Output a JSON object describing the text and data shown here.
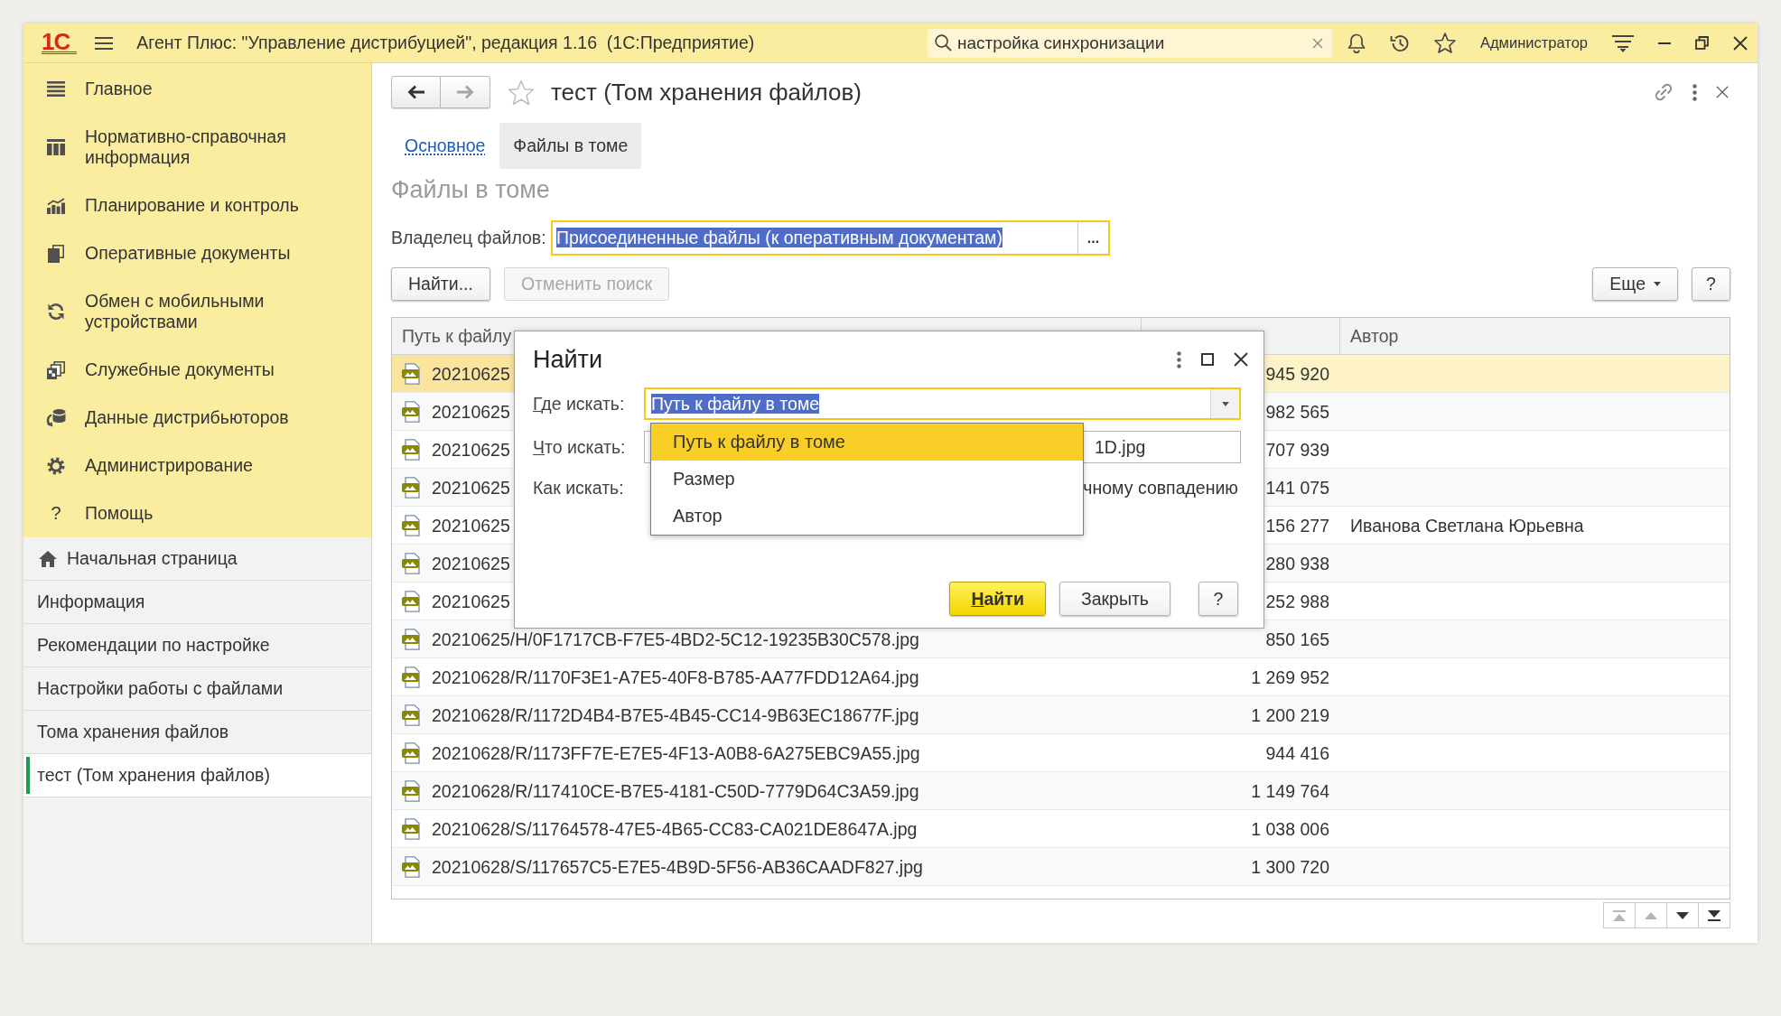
{
  "app_bar": {
    "logo": "1С",
    "title": "Агент Плюс: \"Управление дистрибуцией\", редакция 1.16  (1С:Предприятие)",
    "search": {
      "value": "настройка синхронизации"
    },
    "user": "Администратор"
  },
  "sidebar": {
    "sections": [
      {
        "label": "Главное"
      },
      {
        "label": "Нормативно-справочная информация"
      },
      {
        "label": "Планирование и контроль"
      },
      {
        "label": "Оперативные документы"
      },
      {
        "label": "Обмен с мобильными устройствами"
      },
      {
        "label": "Служебные документы"
      },
      {
        "label": "Данные дистрибьюторов"
      },
      {
        "label": "Администрирование"
      },
      {
        "label": "Помощь",
        "glyph": "?"
      }
    ],
    "open_pages": [
      {
        "kind": "home",
        "label": "Начальная страница",
        "selected": false
      },
      {
        "kind": "page",
        "label": "Информация",
        "selected": false
      },
      {
        "kind": "page",
        "label": "Рекомендации по настройке",
        "selected": false
      },
      {
        "kind": "page",
        "label": "Настройки работы с файлами",
        "selected": false
      },
      {
        "kind": "page",
        "label": "Тома хранения файлов",
        "selected": false
      },
      {
        "kind": "page",
        "label": "тест (Том хранения файлов)",
        "selected": true
      }
    ]
  },
  "page": {
    "nav": {
      "back_disabled": false,
      "forward_disabled": true
    },
    "favorite": false,
    "title": "тест (Том хранения файлов)",
    "tabs": [
      {
        "label": "Основное",
        "selected": false
      },
      {
        "label": "Файлы в томе",
        "selected": true
      }
    ],
    "section_title": "Файлы в томе",
    "owner_field": {
      "label": "Владелец файлов:",
      "value": "Присоединенные файлы (к оперативным документам)",
      "choice_button": "...",
      "focused": true
    },
    "toolbar_left": [
      {
        "kind": "button",
        "label": "Найти...",
        "disabled": false
      },
      {
        "kind": "button",
        "label": "Отменить поиск",
        "disabled": true
      }
    ],
    "toolbar_right": [
      {
        "kind": "menu",
        "label": "Еще",
        "disabled": false
      },
      {
        "kind": "help",
        "label": "?",
        "disabled": false
      }
    ],
    "table": {
      "columns": [
        {
          "kind": "path",
          "label": "Путь к файлу"
        },
        {
          "kind": "size"
        },
        {
          "kind": "author",
          "label": "Автор"
        }
      ],
      "rows": [
        {
          "path": "20210625",
          "size": "945 920",
          "selected": true
        },
        {
          "path": "20210625",
          "size": "982 565",
          "selected": false
        },
        {
          "path": "20210625",
          "size": "707 939",
          "selected": false
        },
        {
          "path": "20210625",
          "size": "141 075",
          "selected": false
        },
        {
          "path": "20210625",
          "size": "156 277",
          "author": "Иванова Светлана Юрьевна",
          "selected": false
        },
        {
          "path": "20210625",
          "size": "280 938",
          "selected": false
        },
        {
          "path": "20210625",
          "size": "252 988",
          "selected": false
        },
        {
          "path": "20210625/H/0F1717CB-F7E5-4BD2-5C12-19235B30C578.jpg",
          "size": "850 165",
          "selected": false
        },
        {
          "path": "20210628/R/1170F3E1-A7E5-40F8-B785-AA77FDD12A64.jpg",
          "size": "1 269 952",
          "selected": false
        },
        {
          "path": "20210628/R/1172D4B4-B7E5-4B45-CC14-9B63EC18677F.jpg",
          "size": "1 200 219",
          "selected": false
        },
        {
          "path": "20210628/R/1173FF7E-E7E5-4F13-A0B8-6A275EBC9A55.jpg",
          "size": "944 416",
          "selected": false
        },
        {
          "path": "20210628/R/117410CE-B7E5-4181-C50D-7779D64C3A59.jpg",
          "size": "1 149 764",
          "selected": false
        },
        {
          "path": "20210628/S/11764578-47E5-4B65-CC83-CA021DE8647A.jpg",
          "size": "1 038 006",
          "selected": false
        },
        {
          "path": "20210628/S/117657C5-E7E5-4B9D-5F56-AB36CAADF827.jpg",
          "size": "1 300 720",
          "selected": false
        }
      ]
    },
    "pager": [
      {
        "disabled": true
      },
      {
        "disabled": true
      },
      {
        "disabled": false
      },
      {
        "disabled": false
      }
    ]
  },
  "find_dialog": {
    "title": "Найти",
    "fields": [
      {
        "kind": "dropdown",
        "label": "Где искать:",
        "mnemonic": true,
        "value": "Путь к файлу в томе",
        "focused": true,
        "open": true,
        "options": [
          {
            "label": "Путь к файлу в томе",
            "selected": true
          },
          {
            "label": "Размер",
            "selected": false
          },
          {
            "label": "Автор",
            "selected": false
          }
        ]
      },
      {
        "kind": "text",
        "label": "Что искать:",
        "mnemonic": true,
        "value": "1D.jpg"
      },
      {
        "kind": "radio",
        "label": "Как искать:",
        "mnemonic": false,
        "value": "чному совпадению"
      }
    ],
    "buttons": [
      {
        "kind": "default",
        "label": "Найти",
        "mnemonic": true
      },
      {
        "kind": "normal",
        "label": "Закрыть",
        "mnemonic": false
      },
      {
        "kind": "help",
        "label": "?",
        "mnemonic": false
      }
    ]
  }
}
